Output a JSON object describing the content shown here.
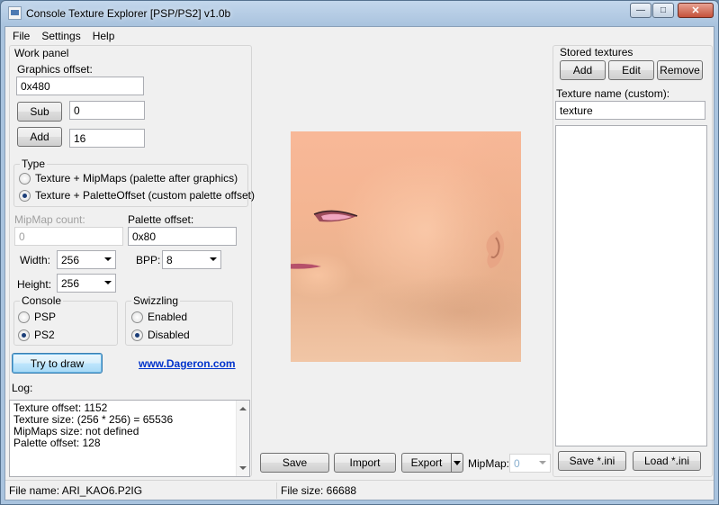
{
  "window": {
    "title": "Console Texture Explorer [PSP/PS2] v1.0b"
  },
  "titlebar": {
    "minimize": "—",
    "maximize": "□",
    "close": "✕"
  },
  "menu": [
    "File",
    "Settings",
    "Help"
  ],
  "work_panel": {
    "title": "Work panel",
    "graphics_offset_label": "Graphics offset:",
    "graphics_offset_value": "0x480",
    "sub_label": "Sub",
    "sub_value": "0",
    "add_label": "Add",
    "add_value": "16",
    "type_title": "Type",
    "type_options": [
      {
        "label": "Texture + MipMaps (palette after graphics)",
        "selected": false
      },
      {
        "label": "Texture + PaletteOffset (custom palette offset)",
        "selected": true
      }
    ],
    "mipmap_count_label": "MipMap count:",
    "mipmap_count_value": "0",
    "palette_offset_label": "Palette offset:",
    "palette_offset_value": "0x80",
    "width_label": "Width:",
    "width_value": "256",
    "height_label": "Height:",
    "height_value": "256",
    "bpp_label": "BPP:",
    "bpp_value": "8",
    "console_title": "Console",
    "console_options": [
      {
        "label": "PSP",
        "selected": false
      },
      {
        "label": "PS2",
        "selected": true
      }
    ],
    "swizzling_title": "Swizzling",
    "swizzling_options": [
      {
        "label": "Enabled",
        "selected": false
      },
      {
        "label": "Disabled",
        "selected": true
      }
    ],
    "try_draw_label": "Try to draw",
    "link_text": "www.Dageron.com",
    "log_label": "Log:",
    "log_lines": [
      "Texture offset: 1152",
      "Texture size: (256 * 256) = 65536",
      "MipMaps size: not defined",
      "Palette offset: 128"
    ]
  },
  "center": {
    "save_label": "Save",
    "import_label": "Import",
    "export_label": "Export",
    "mipmap_label": "MipMap:",
    "mipmap_value": "0"
  },
  "stored_textures": {
    "title": "Stored textures",
    "add_label": "Add",
    "edit_label": "Edit",
    "remove_label": "Remove",
    "name_label": "Texture name (custom):",
    "name_value": "texture",
    "save_ini_label": "Save *.ini",
    "load_ini_label": "Load *.ini"
  },
  "status": {
    "file_name": "File name: ARI_KAO6.P2IG",
    "file_size": "File size: 66688"
  }
}
